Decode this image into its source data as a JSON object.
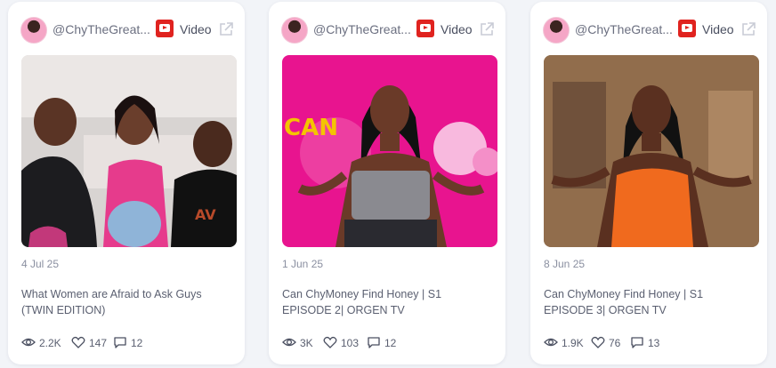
{
  "cards": [
    {
      "handle": "@ChyTheGreat...",
      "source": "Video",
      "date": "4 Jul 25",
      "title": "What Women are Afraid to Ask Guys (TWIN EDITION)",
      "views": "2.2K",
      "likes": "147",
      "comments": "12"
    },
    {
      "handle": "@ChyTheGreat...",
      "source": "Video",
      "date": "1 Jun 25",
      "title": "Can ChyMoney Find Honey | S1 EPISODE 2| ORGEN TV",
      "views": "3K",
      "likes": "103",
      "comments": "12"
    },
    {
      "handle": "@ChyTheGreat...",
      "source": "Video",
      "date": "8 Jun 25",
      "title": "Can ChyMoney Find Honey | S1 EPISODE 3| ORGEN TV",
      "views": "1.9K",
      "likes": "76",
      "comments": "13"
    }
  ],
  "icons": {
    "source": "youtube-icon",
    "external": "external-link-icon",
    "views": "eye-icon",
    "likes": "heart-icon",
    "comments": "comment-icon"
  },
  "colors": {
    "youtube_red": "#e0231f",
    "card_bg": "#ffffff",
    "page_bg": "#f2f4f8",
    "text_muted": "#8a8fa0"
  }
}
